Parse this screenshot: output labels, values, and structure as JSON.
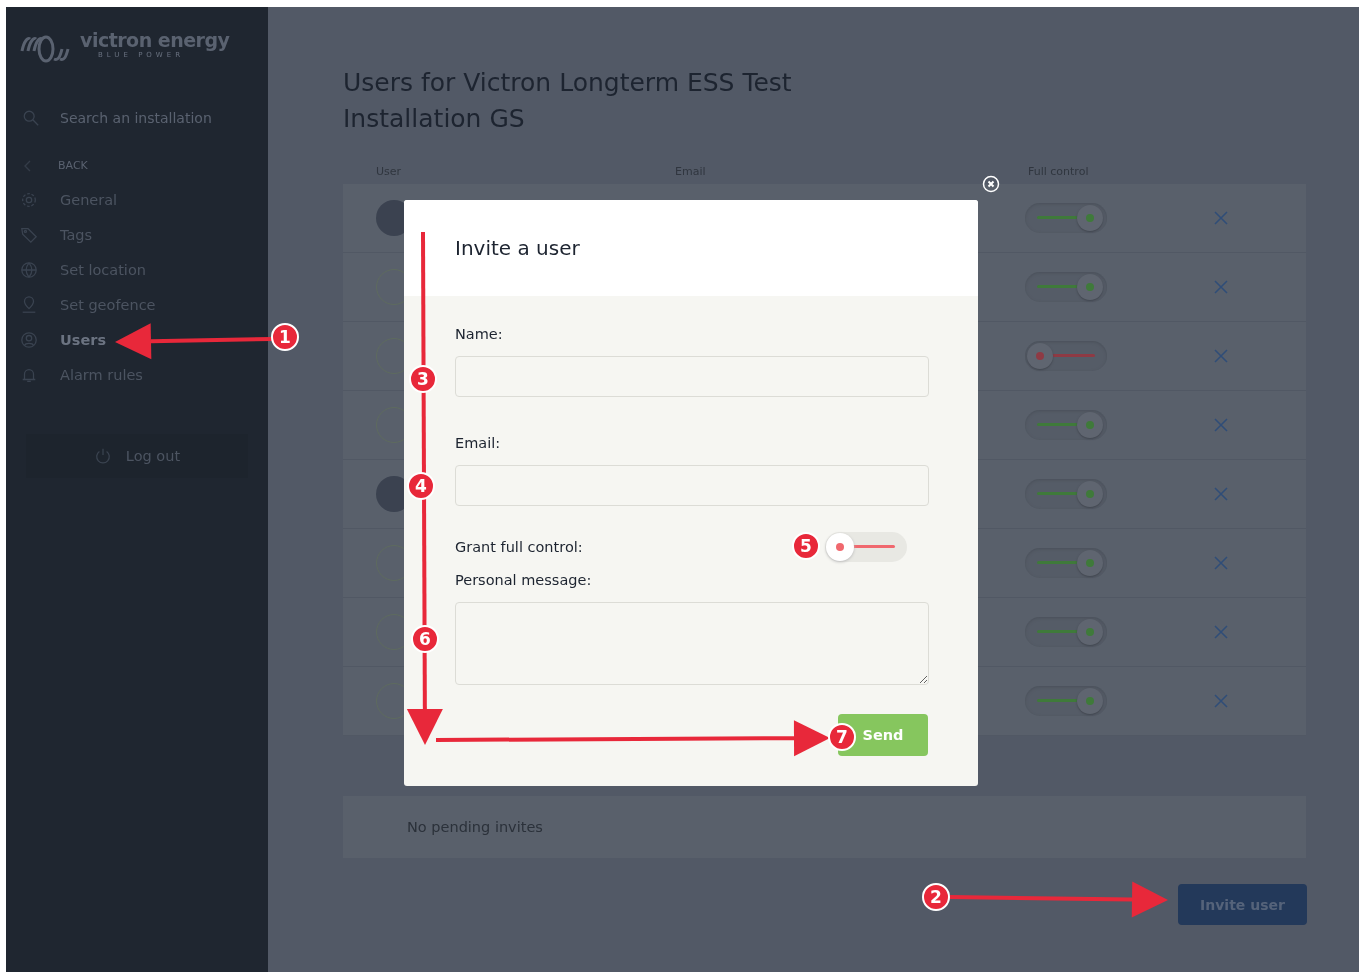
{
  "sidebar": {
    "logo": "victron energy",
    "logo_tagline": "BLUE POWER",
    "search": {
      "placeholder": "Search an installation"
    },
    "back": "BACK",
    "items": [
      {
        "label": "General",
        "selected": false
      },
      {
        "label": "Tags",
        "selected": false
      },
      {
        "label": "Set location",
        "selected": false
      },
      {
        "label": "Set geofence",
        "selected": false
      },
      {
        "label": "Users",
        "selected": true
      },
      {
        "label": "Alarm rules",
        "selected": false
      }
    ],
    "logout": "Log out"
  },
  "page": {
    "title": "Users for Victron Longterm ESS Test Installation GS",
    "users_table": {
      "columns": [
        "User",
        "Email",
        "Full control"
      ],
      "rows": [
        {
          "kind": "photo",
          "full_control": true
        },
        {
          "kind": "circle",
          "full_control": true
        },
        {
          "kind": "circle",
          "full_control": false
        },
        {
          "kind": "circle",
          "full_control": true
        },
        {
          "kind": "photo",
          "full_control": true
        },
        {
          "kind": "circle",
          "full_control": true
        },
        {
          "kind": "circle",
          "full_control": true
        },
        {
          "kind": "circle",
          "full_control": true
        }
      ]
    },
    "pending": {
      "empty_text": "No pending invites"
    },
    "invite_button": "Invite user"
  },
  "dialog": {
    "title": "Invite a user",
    "name": {
      "label": "Name:"
    },
    "email": {
      "label": "Email:"
    },
    "full_control": {
      "label": "Grant full control:",
      "on": false
    },
    "message": {
      "label": "Personal message:"
    },
    "send": "Send"
  },
  "annotations": [
    {
      "number": "1"
    },
    {
      "number": "2"
    },
    {
      "number": "3"
    },
    {
      "number": "4"
    },
    {
      "number": "5"
    },
    {
      "number": "6"
    },
    {
      "number": "7"
    }
  ]
}
